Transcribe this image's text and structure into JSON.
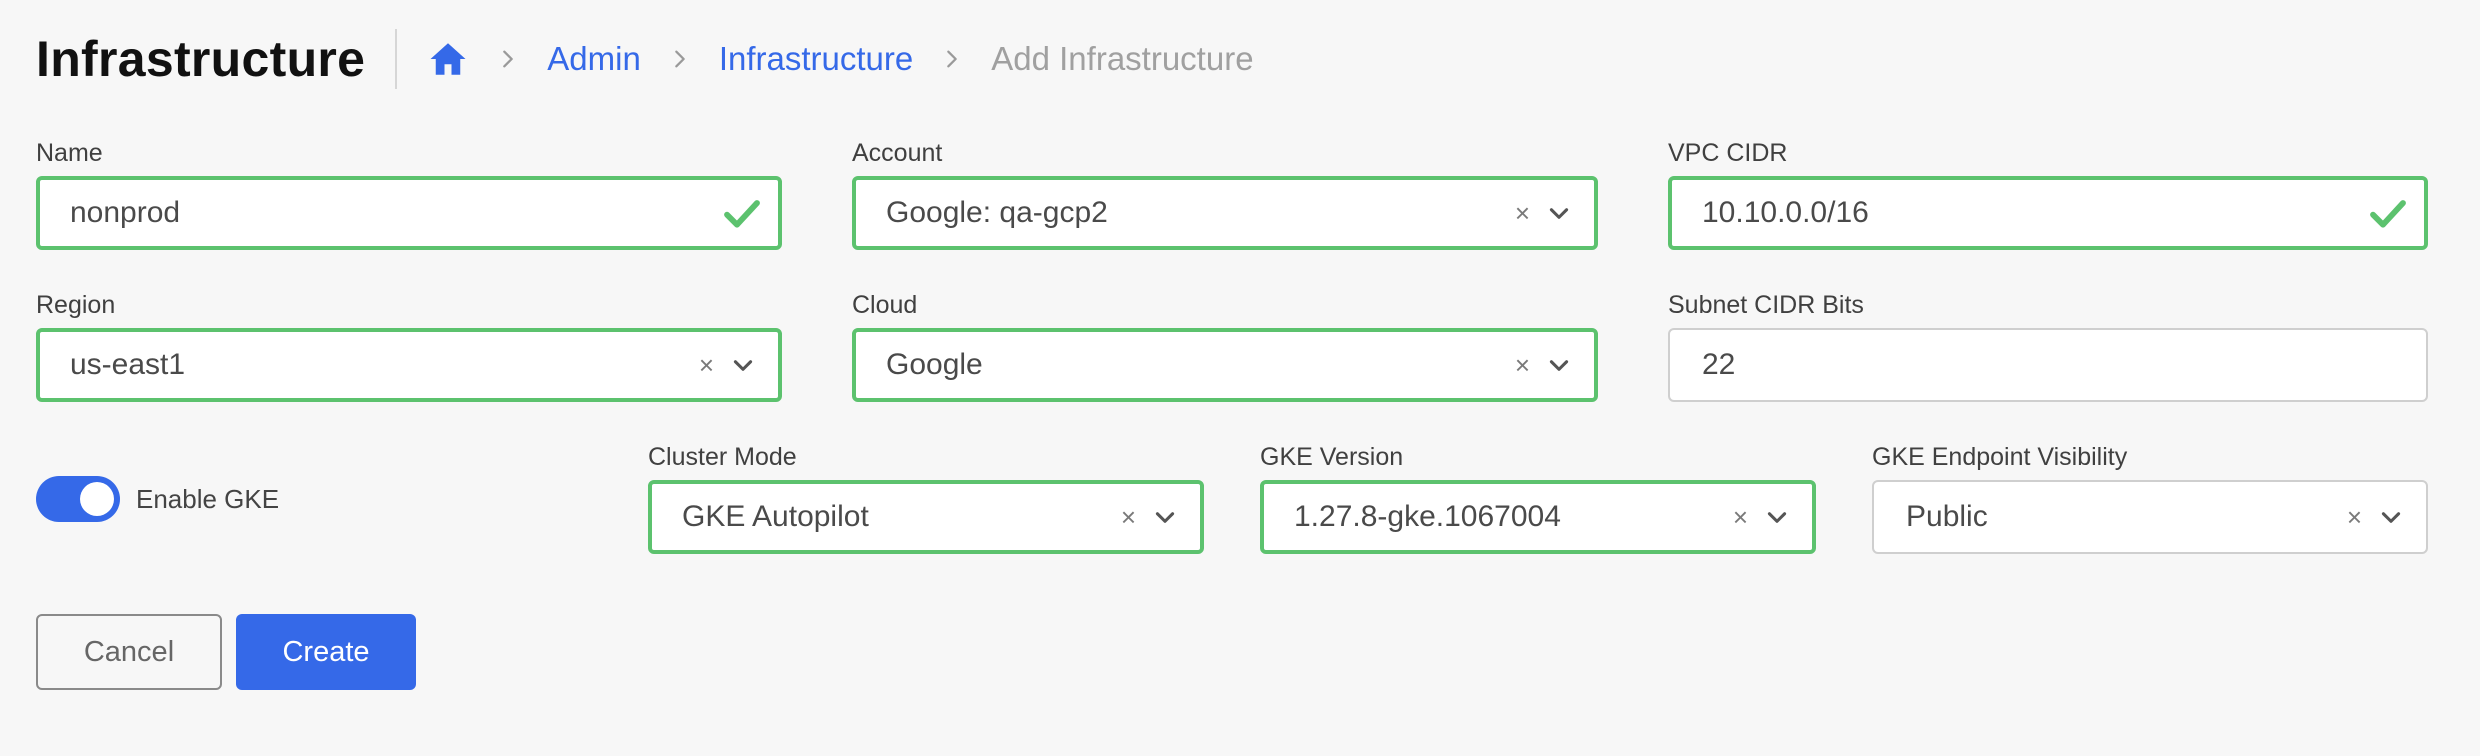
{
  "header": {
    "title": "Infrastructure",
    "breadcrumb": [
      "Admin",
      "Infrastructure",
      "Add Infrastructure"
    ]
  },
  "form": {
    "name": {
      "label": "Name",
      "value": "nonprod"
    },
    "account": {
      "label": "Account",
      "value": "Google: qa-gcp2"
    },
    "vpc_cidr": {
      "label": "VPC CIDR",
      "value": "10.10.0.0/16"
    },
    "region": {
      "label": "Region",
      "value": "us-east1"
    },
    "cloud": {
      "label": "Cloud",
      "value": "Google"
    },
    "subnet_cidr_bits": {
      "label": "Subnet CIDR Bits",
      "value": "22"
    },
    "enable_gke": {
      "label": "Enable GKE",
      "enabled": true
    },
    "cluster_mode": {
      "label": "Cluster Mode",
      "value": "GKE Autopilot"
    },
    "gke_version": {
      "label": "GKE Version",
      "value": "1.27.8-gke.1067004"
    },
    "gke_endpoint_visibility": {
      "label": "GKE Endpoint Visibility",
      "value": "Public"
    }
  },
  "clear_glyph": "×",
  "buttons": {
    "cancel": "Cancel",
    "create": "Create"
  },
  "colors": {
    "accent": "#3569e8",
    "valid": "#5cc26e"
  }
}
